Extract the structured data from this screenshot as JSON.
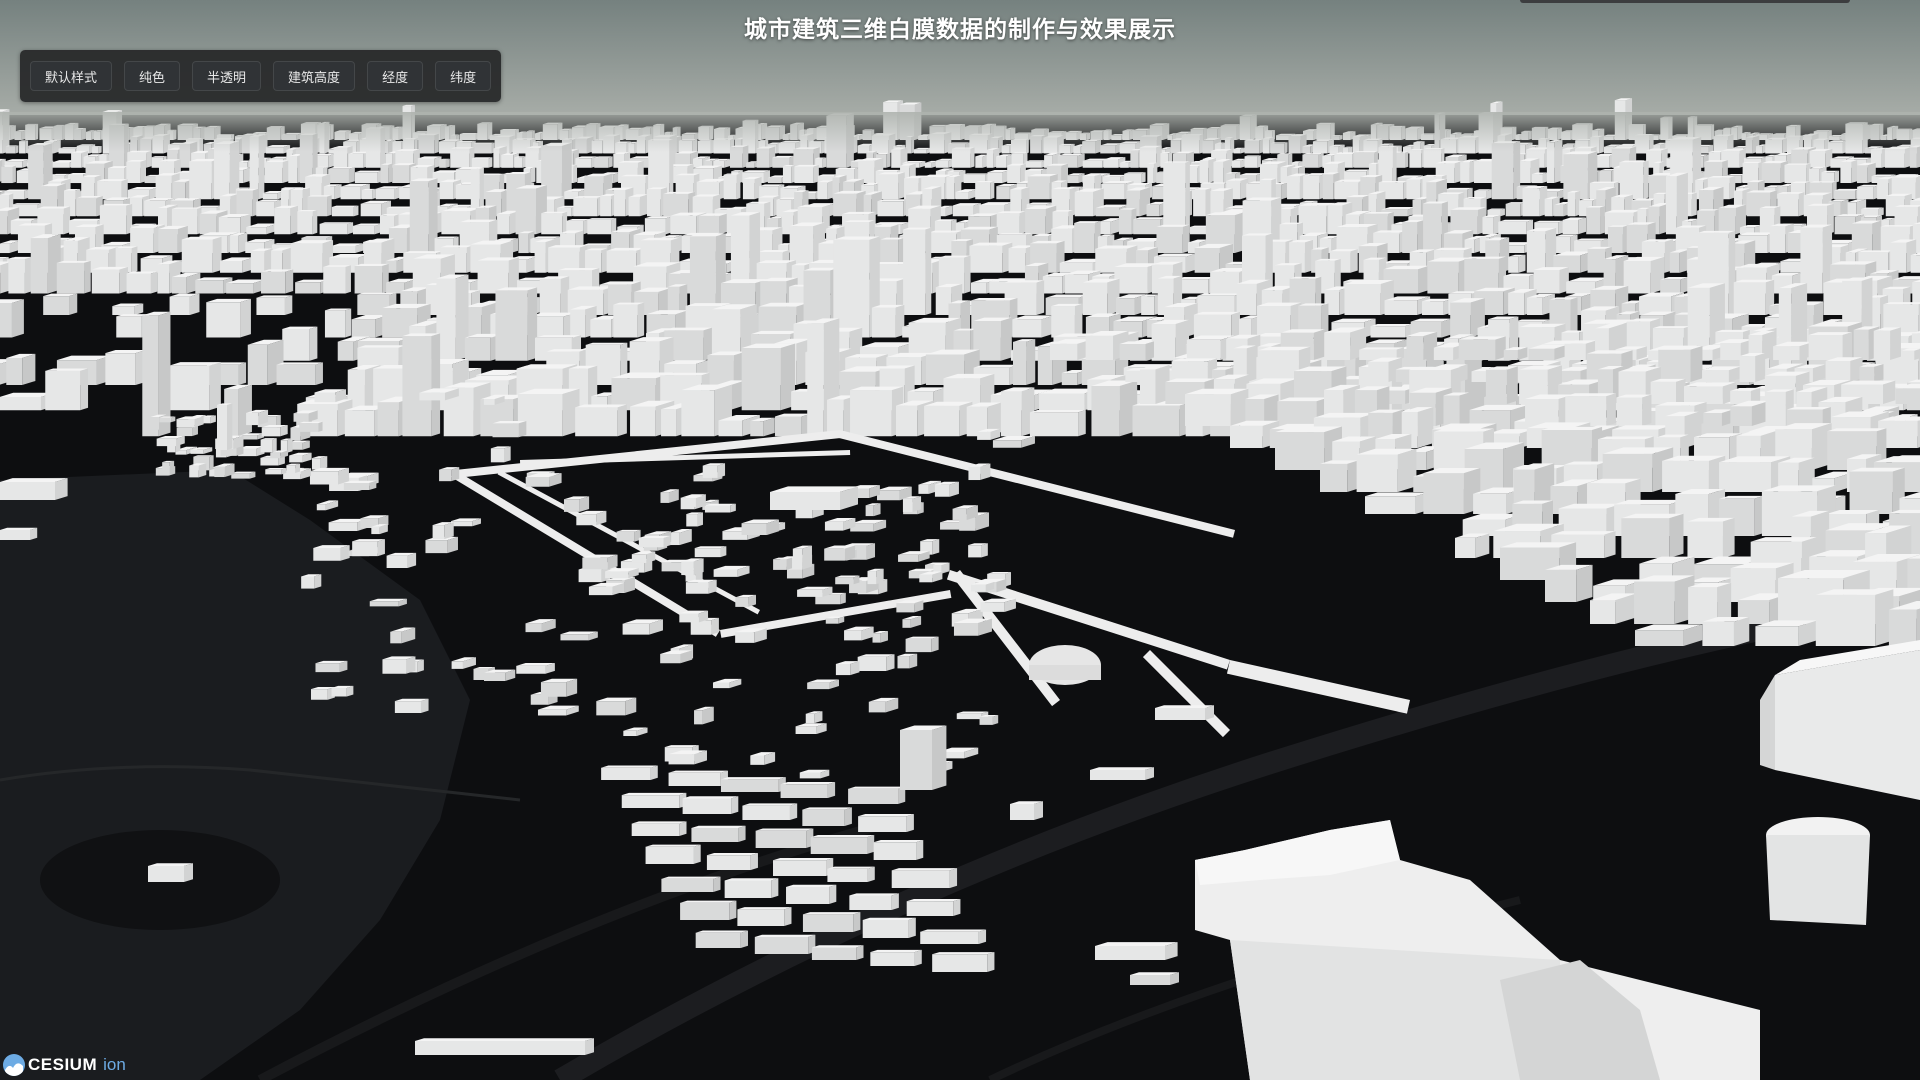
{
  "header": {
    "title": "城市建筑三维白膜数据的制作与效果展示"
  },
  "toolbar": {
    "buttons": [
      {
        "id": "default",
        "label": "默认样式"
      },
      {
        "id": "solid",
        "label": "纯色"
      },
      {
        "id": "translucent",
        "label": "半透明"
      },
      {
        "id": "height",
        "label": "建筑高度"
      },
      {
        "id": "longitude",
        "label": "经度"
      },
      {
        "id": "latitude",
        "label": "纬度"
      }
    ]
  },
  "credit": {
    "logo_text": "CESIUM",
    "ion_text": "ion",
    "icon": "cesium-logo-icon"
  },
  "scene": {
    "sky_top_color": "#75817f",
    "sky_horizon_color": "#a8ada8",
    "ground_color": "#0d0e10",
    "building_color": "#f0f0f0",
    "description_icon": "3d-white-building-city-scene"
  }
}
